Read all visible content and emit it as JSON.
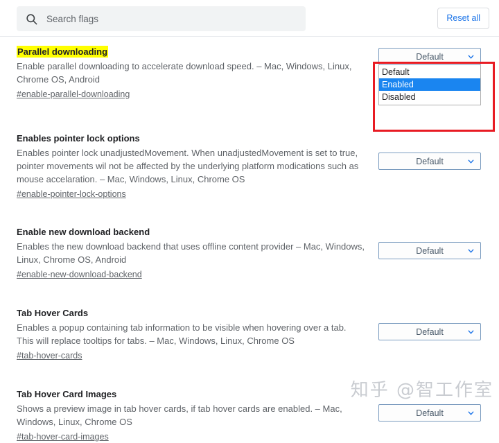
{
  "search": {
    "placeholder": "Search flags",
    "value": "",
    "icon": "search-icon"
  },
  "toolbar": {
    "reset_all_label": "Reset all"
  },
  "select_options": [
    "Default",
    "Enabled",
    "Disabled"
  ],
  "colors": {
    "accent": "#1a73e8",
    "highlight": "#ffff00",
    "annotation": "#e81b23",
    "option_selected_bg": "#1a85f0",
    "search_bg": "#f1f3f4"
  },
  "flags": [
    {
      "title": "Parallel downloading",
      "highlighted": true,
      "description": "Enable parallel downloading to accelerate download speed. – Mac, Windows, Linux, Chrome OS, Android",
      "id": "#enable-parallel-downloading",
      "value": "Default",
      "dropdown_open": true,
      "dropdown_highlighted_option": "Enabled"
    },
    {
      "title": "Enables pointer lock options",
      "highlighted": false,
      "description": "Enables pointer lock unadjustedMovement. When unadjustedMovement is set to true, pointer movements wil not be affected by the underlying platform modications such as mouse accelaration. – Mac, Windows, Linux, Chrome OS",
      "id": "#enable-pointer-lock-options",
      "value": "Default",
      "dropdown_open": false
    },
    {
      "title": "Enable new download backend",
      "highlighted": false,
      "description": "Enables the new download backend that uses offline content provider – Mac, Windows, Linux, Chrome OS, Android",
      "id": "#enable-new-download-backend",
      "value": "Default",
      "dropdown_open": false
    },
    {
      "title": "Tab Hover Cards",
      "highlighted": false,
      "description": "Enables a popup containing tab information to be visible when hovering over a tab. This will replace tooltips for tabs. – Mac, Windows, Linux, Chrome OS",
      "id": "#tab-hover-cards",
      "value": "Default",
      "dropdown_open": false
    },
    {
      "title": "Tab Hover Card Images",
      "highlighted": false,
      "description": "Shows a preview image in tab hover cards, if tab hover cards are enabled. – Mac, Windows, Linux, Chrome OS",
      "id": "#tab-hover-card-images",
      "value": "Default",
      "dropdown_open": false
    }
  ],
  "watermark": {
    "text": "知乎 @智工作室"
  }
}
